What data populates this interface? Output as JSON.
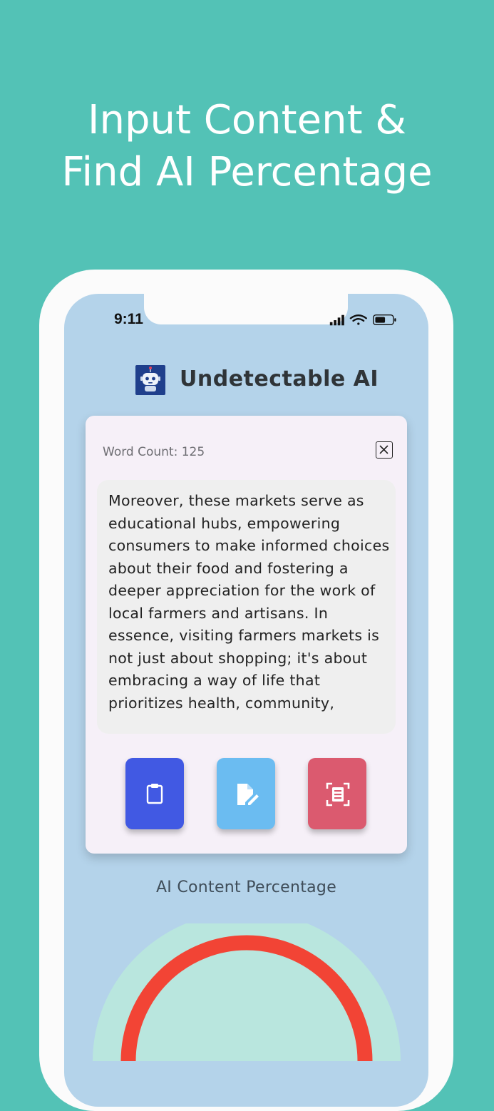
{
  "promo": {
    "headline_line1": "Input Content &",
    "headline_line2": "Find AI Percentage"
  },
  "status_bar": {
    "time": "9:11"
  },
  "app": {
    "title": "Undetectable AI"
  },
  "card": {
    "word_count": "Word Count: 125",
    "text": "Moreover, these markets serve as educational hubs, empowering consumers to make informed choices about their food and fostering a deeper appreciation for the work of local farmers and artisans. In essence, visiting farmers markets is not just about shopping; it's about embracing a way of life that prioritizes health, community,"
  },
  "actions": [
    {
      "name": "paste",
      "icon": "clipboard-icon",
      "color": "#4159e3"
    },
    {
      "name": "edit",
      "icon": "document-edit-icon",
      "color": "#6bbcf1"
    },
    {
      "name": "scan",
      "icon": "document-scan-icon",
      "color": "#db5a6f"
    }
  ],
  "result": {
    "section_title": "AI Content Percentage",
    "gauge_track_color": "#b9e6de",
    "gauge_fill_color": "#f24435"
  },
  "colors": {
    "background": "#53c2b6",
    "screen": "#b4d3ea",
    "card": "#f6f0f8"
  }
}
